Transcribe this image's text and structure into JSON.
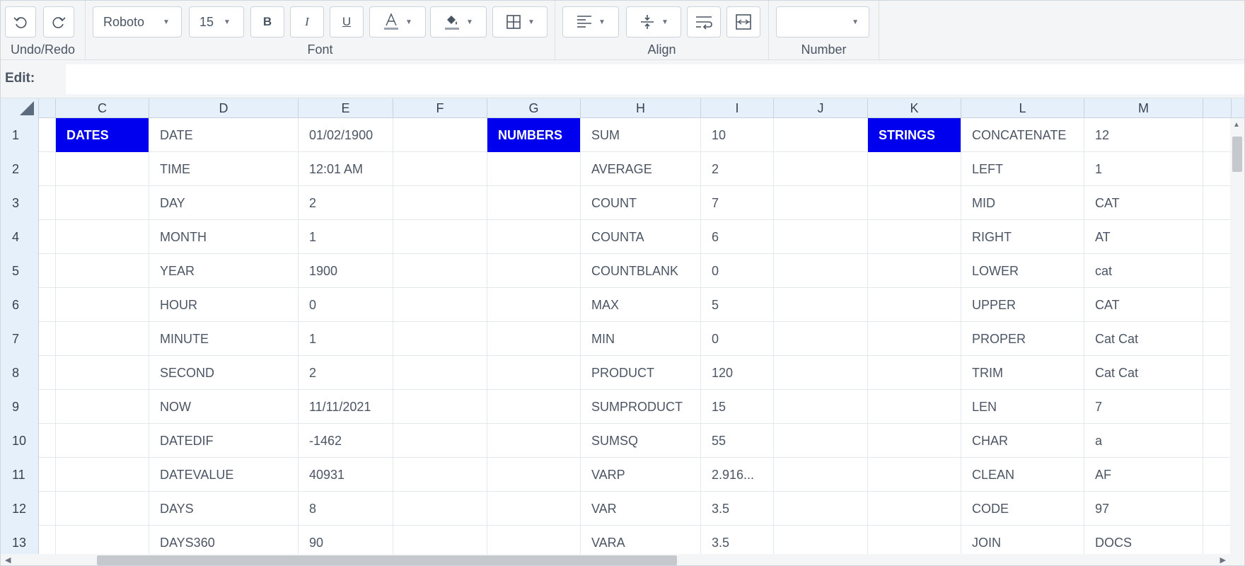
{
  "toolbar": {
    "groups": [
      {
        "label": "Undo/Redo"
      },
      {
        "label": "Font"
      },
      {
        "label": "Align"
      },
      {
        "label": "Number"
      }
    ],
    "font_family": "Roboto",
    "font_size": "15",
    "bold_label": "B",
    "italic_label": "I",
    "underline_label": "U",
    "number_format": "",
    "icons": [
      "undo-icon",
      "redo-icon",
      "text-color-icon",
      "fill-color-icon",
      "borders-icon",
      "align-left-icon",
      "align-vertical-icon",
      "wrap-text-icon",
      "merge-cells-icon"
    ]
  },
  "editbar": {
    "label": "Edit:",
    "value": ""
  },
  "columns": [
    "",
    "C",
    "D",
    "E",
    "F",
    "G",
    "H",
    "I",
    "J",
    "K",
    "L",
    "M",
    ""
  ],
  "rows": [
    {
      "num": "1",
      "cells": [
        "",
        "DATES",
        "DATE",
        "01/02/1900",
        "",
        "NUMBERS",
        "SUM",
        "10",
        "",
        "STRINGS",
        "CONCATENATE",
        "12",
        ""
      ]
    },
    {
      "num": "2",
      "cells": [
        "",
        "",
        "TIME",
        "12:01 AM",
        "",
        "",
        "AVERAGE",
        "2",
        "",
        "",
        "LEFT",
        "1",
        ""
      ]
    },
    {
      "num": "3",
      "cells": [
        "",
        "",
        "DAY",
        "2",
        "",
        "",
        "COUNT",
        "7",
        "",
        "",
        "MID",
        "CAT",
        ""
      ]
    },
    {
      "num": "4",
      "cells": [
        "",
        "",
        "MONTH",
        "1",
        "",
        "",
        "COUNTA",
        "6",
        "",
        "",
        "RIGHT",
        "AT",
        ""
      ]
    },
    {
      "num": "5",
      "cells": [
        "",
        "",
        "YEAR",
        "1900",
        "",
        "",
        "COUNTBLANK",
        "0",
        "",
        "",
        "LOWER",
        "cat",
        ""
      ]
    },
    {
      "num": "6",
      "cells": [
        "",
        "",
        "HOUR",
        "0",
        "",
        "",
        "MAX",
        "5",
        "",
        "",
        "UPPER",
        "CAT",
        ""
      ]
    },
    {
      "num": "7",
      "cells": [
        "",
        "",
        "MINUTE",
        "1",
        "",
        "",
        "MIN",
        "0",
        "",
        "",
        "PROPER",
        "Cat Cat",
        ""
      ]
    },
    {
      "num": "8",
      "cells": [
        "",
        "",
        "SECOND",
        "2",
        "",
        "",
        "PRODUCT",
        "120",
        "",
        "",
        "TRIM",
        "Cat Cat",
        ""
      ]
    },
    {
      "num": "9",
      "cells": [
        "",
        "",
        "NOW",
        "11/11/2021",
        "",
        "",
        "SUMPRODUCT",
        "15",
        "",
        "",
        "LEN",
        "7",
        ""
      ]
    },
    {
      "num": "10",
      "cells": [
        "",
        "",
        "DATEDIF",
        "-1462",
        "",
        "",
        "SUMSQ",
        "55",
        "",
        "",
        "CHAR",
        "a",
        ""
      ]
    },
    {
      "num": "11",
      "cells": [
        "",
        "",
        "DATEVALUE",
        "40931",
        "",
        "",
        "VARP",
        "2.916...",
        "",
        "",
        "CLEAN",
        "AF",
        ""
      ]
    },
    {
      "num": "12",
      "cells": [
        "",
        "",
        "DAYS",
        "8",
        "",
        "",
        "VAR",
        "3.5",
        "",
        "",
        "CODE",
        "97",
        ""
      ]
    },
    {
      "num": "13",
      "cells": [
        "",
        "",
        "DAYS360",
        "90",
        "",
        "",
        "VARA",
        "3.5",
        "",
        "",
        "JOIN",
        "DOCS",
        ""
      ]
    }
  ],
  "highlight_color": "#0000ee",
  "header_bg": "#e5f0fa"
}
